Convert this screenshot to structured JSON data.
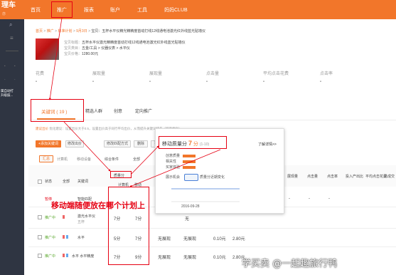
{
  "brand": {
    "name": "理车",
    "sub": "亦"
  },
  "topnav": {
    "items": [
      "首页",
      "推广",
      "报表",
      "账户",
      "工具",
      "妈妈CLUB"
    ]
  },
  "sidebar": {
    "plan_text_1": "属自动打",
    "plan_text_2": "升级鼓..."
  },
  "breadcrumb": {
    "items": [
      "首页",
      "推广",
      "标准计划",
      "9月3日",
      "宝贝：五杯水平仪精光精精度首动打线12线通电池激光红外线蓝光贴墙仪"
    ],
    "seps": [
      ">",
      ">",
      ">",
      ">"
    ]
  },
  "product": {
    "label_title": "宝贝标题：",
    "title": "五杯水平仪激光精精度首动打线12线通电池激光红外线蓝光贴墙仪",
    "label_category": "宝贝类目：",
    "category": "五金/工具 > 仪器仪表 > 水平仪",
    "label_price": "宝贝价格：",
    "price": "1280.00元"
  },
  "metrics": {
    "headers": [
      "花费",
      "展现量",
      "展现量",
      "点击量",
      "平均点击花费",
      "点击率"
    ],
    "values": [
      "-",
      "-",
      "-",
      "-",
      "-",
      "-"
    ]
  },
  "tabs": [
    {
      "label": "关键词 ( 19 )",
      "active": true
    },
    {
      "label": "精选人群",
      "active": false
    },
    {
      "label": "创意",
      "active": false
    },
    {
      "label": "定向推广",
      "active": false
    }
  ],
  "tips": {
    "prefix": "建议出价",
    "text": "优化建议：设置出价大于0.5，设置出价高于同行平均出价，从而提升关键词排名（展示优化）"
  },
  "toolbar": {
    "add_keyword": "+添加关键词",
    "modify_price": "修改出价",
    "modify_match": "修改匹配方式",
    "delete": "删除",
    "more": "更多"
  },
  "view_tabs": {
    "summary": "汇总",
    "pc": "计算机",
    "mobile": "移动设备",
    "more": "其他"
  },
  "filters": {
    "sort": "1",
    "all_status": "综合条件",
    "all": "全部"
  },
  "table": {
    "headers": [
      "状态",
      "全部",
      "关键词",
      "质量分",
      "计算机",
      "移动",
      "出价",
      "展现量",
      "点击量",
      "点击率",
      "投入产出比",
      "平均点击花费",
      "总成交"
    ],
    "quality_header": "质量分",
    "rows": [
      {
        "status": "暂停",
        "keyword": "智能匹配",
        "qs_pc": "-",
        "qs_mobile": "-",
        "bid": "-",
        "vals": [
          "-",
          "-",
          "-",
          "-",
          "-"
        ]
      },
      {
        "status": "推广中",
        "keyword": "激光水平仪",
        "sub": "五杯",
        "qs_pc": "7分",
        "qs_mobile": "7分",
        "bid": "无",
        "vals": [
          "-",
          "-",
          "-",
          "-",
          "-"
        ]
      },
      {
        "status": "推广中",
        "keyword": "水平",
        "sub": "",
        "qs_pc": "5分",
        "qs_mobile": "7分",
        "bid": "无展现",
        "vals": [
          "无展现",
          "0.10元",
          "2.80元",
          "-",
          "-"
        ]
      },
      {
        "status": "推广中",
        "keyword": "水平 水平精度",
        "sub": "",
        "qs_pc": "7分",
        "qs_mobile": "9分",
        "bid": "无展现",
        "vals": [
          "无展现",
          "0.10元",
          "2.80元",
          "-",
          "-"
        ]
      }
    ]
  },
  "popup": {
    "title": "移动质量分",
    "score": "7",
    "unit": "分",
    "max": "(1-10)",
    "link": "了解详情>>",
    "rows": [
      "创意质量",
      "相关性",
      "买家体验"
    ],
    "scale_label": "展示机会",
    "legend": "质量分近期变化",
    "date": "2016-09-28",
    "chart_values": [
      10,
      10,
      10,
      10,
      10,
      10,
      10
    ],
    "colors": {
      "bar": "#9ac0e6",
      "line": "#4a7fd6"
    }
  },
  "annotation": "移动端随便放在哪个计划上",
  "watermark": "学买卖 @一起趣旅行鸭",
  "colors": {
    "accent": "#f2762a",
    "sidebar": "#2f3542",
    "annotation": "#e60012"
  }
}
